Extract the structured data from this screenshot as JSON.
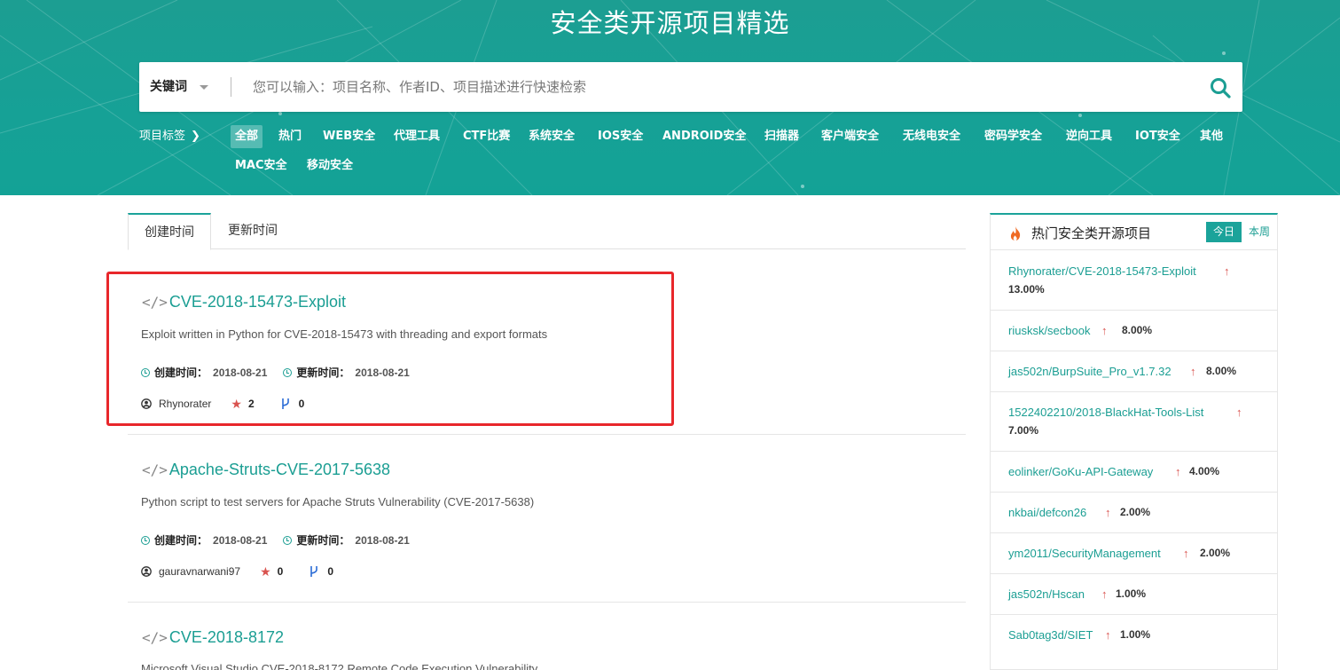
{
  "header": {
    "title": "安全类开源项目精选",
    "search": {
      "type_label": "关键词",
      "placeholder": "您可以输入：项目名称、作者ID、项目描述进行快速检索",
      "value": ""
    },
    "tags_label": "项目标签",
    "tags": [
      "全部",
      "热门",
      "WEB安全",
      "代理工具",
      "CTF比赛",
      "系统安全",
      "IOS安全",
      "ANDROID安全",
      "扫描器",
      "客户端安全",
      "无线电安全",
      "密码学安全",
      "逆向工具",
      "IOT安全",
      "其他",
      "MAC安全",
      "移动安全"
    ],
    "active_tag": "全部"
  },
  "tabs": [
    "创建时间",
    "更新时间"
  ],
  "active_tab": "创建时间",
  "meta_labels": {
    "created": "创建时间：",
    "updated": "更新时间："
  },
  "projects": [
    {
      "code_icon": "</>",
      "name": "CVE-2018-15473-Exploit",
      "description": "Exploit written in Python for CVE-2018-15473 with threading and export formats",
      "created": "2018-08-21",
      "updated": "2018-08-21",
      "author": "Rhynorater",
      "stars": "2",
      "forks": "0"
    },
    {
      "code_icon": "</>",
      "name": "Apache-Struts-CVE-2017-5638",
      "description": "Python script to test servers for Apache Struts Vulnerability (CVE-2017-5638)",
      "created": "2018-08-21",
      "updated": "2018-08-21",
      "author": "gauravnarwani97",
      "stars": "0",
      "forks": "0"
    },
    {
      "code_icon": "</>",
      "name": "CVE-2018-8172",
      "description": "Microsoft Visual Studio CVE-2018-8172 Remote Code Execution Vulnerability"
    }
  ],
  "sidebar": {
    "title": "热门安全类开源项目",
    "tab_today": "今日",
    "tab_week": "本周",
    "items": [
      {
        "name": "Rhynorater/CVE-2018-15473-Exploit",
        "pct": "13.00%"
      },
      {
        "name": "riusksk/secbook",
        "pct": "8.00%"
      },
      {
        "name": "jas502n/BurpSuite_Pro_v1.7.32",
        "pct": "8.00%"
      },
      {
        "name": "1522402210/2018-BlackHat-Tools-List",
        "pct": "7.00%"
      },
      {
        "name": "eolinker/GoKu-API-Gateway",
        "pct": "4.00%"
      },
      {
        "name": "nkbai/defcon26",
        "pct": "2.00%"
      },
      {
        "name": "ym2011/SecurityManagement",
        "pct": "2.00%"
      },
      {
        "name": "jas502n/Hscan",
        "pct": "1.00%"
      },
      {
        "name": "Sab0tag3d/SIET",
        "pct": "1.00%"
      }
    ]
  },
  "colors": {
    "brand": "#1ba39a",
    "link": "#1b9e93",
    "highlight": "#e8272b",
    "star": "#d9534f"
  }
}
